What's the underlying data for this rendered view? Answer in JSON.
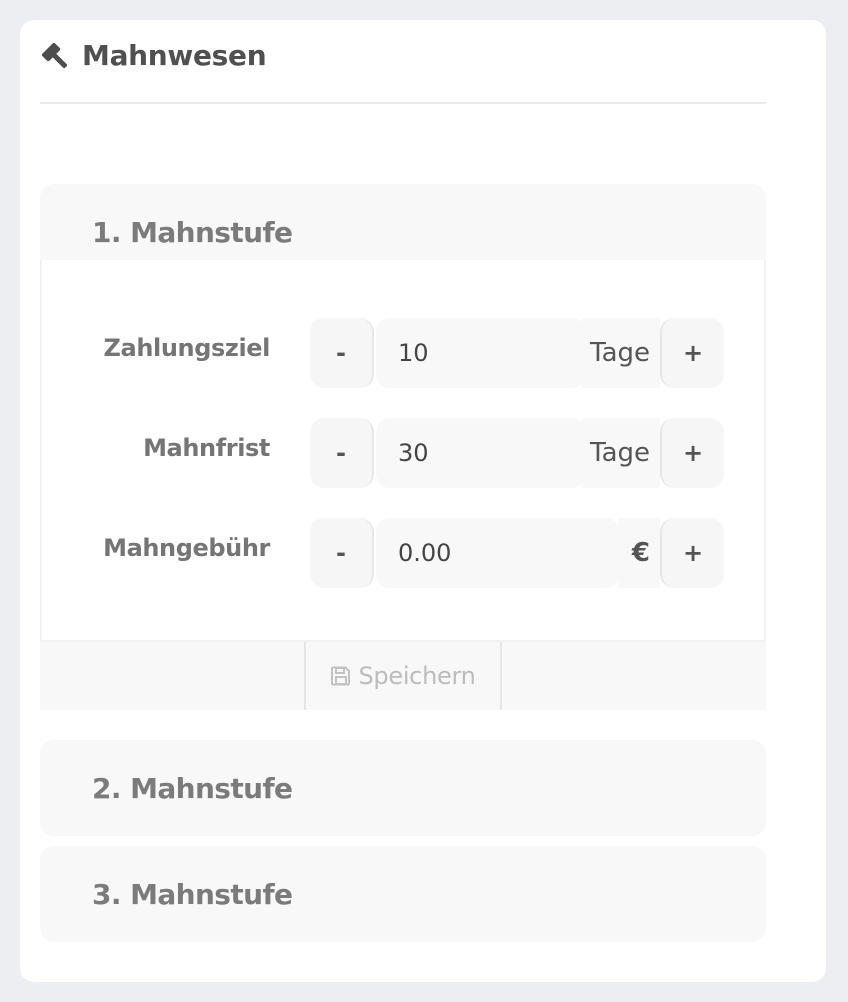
{
  "card": {
    "title": "Mahnwesen",
    "icon": "gavel-icon"
  },
  "levels": [
    {
      "label": "1. Mahnstufe",
      "expanded": true
    },
    {
      "label": "2. Mahnstufe",
      "expanded": false
    },
    {
      "label": "3. Mahnstufe",
      "expanded": false
    }
  ],
  "fields": [
    {
      "label": "Zahlungsziel",
      "minus": "-",
      "plus": "+",
      "value": "10",
      "unit": "Tage"
    },
    {
      "label": "Mahnfrist",
      "minus": "-",
      "plus": "+",
      "value": "30",
      "unit": "Tage"
    },
    {
      "label": "Mahngebühr",
      "minus": "-",
      "plus": "+",
      "value": "0.00",
      "unit": "€"
    }
  ],
  "save": {
    "label": "Speichern",
    "icon": "floppy-disk-icon"
  }
}
